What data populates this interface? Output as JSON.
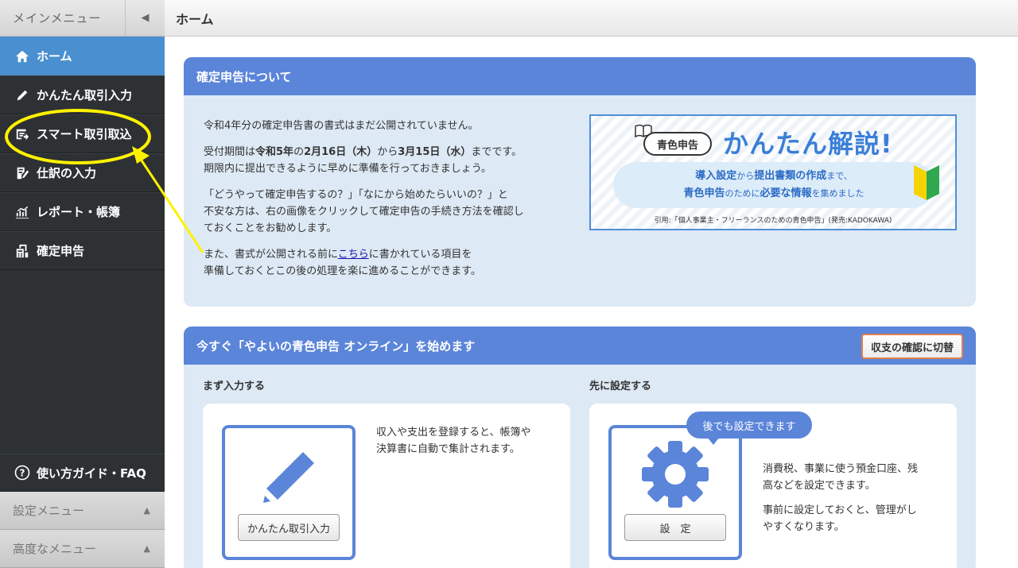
{
  "sidebar": {
    "title": "メインメニュー",
    "collapse_icon": "triangle-left-icon",
    "items": [
      {
        "label": "ホーム",
        "icon": "home-icon",
        "active": true
      },
      {
        "label": "かんたん取引入力",
        "icon": "pencil-icon"
      },
      {
        "label": "スマート取引取込",
        "icon": "import-icon"
      },
      {
        "label": "仕訳の入力",
        "icon": "journal-icon"
      },
      {
        "label": "レポート・帳簿",
        "icon": "report-chart-icon"
      },
      {
        "label": "確定申告",
        "icon": "calculator-icon"
      }
    ],
    "guide_label": "使い方ガイド・FAQ",
    "settings_menu": "設定メニュー",
    "advanced_menu": "高度なメニュー"
  },
  "header": {
    "title": "ホーム"
  },
  "card1": {
    "title": "確定申告について",
    "p1": "令和4年分の確定申告書の書式はまだ公開されていません。",
    "p2_a": "受付期間は",
    "p2_b1": "令和5年",
    "p2_c1": "の",
    "p2_b2": "2月16日（木）",
    "p2_c2": "から",
    "p2_b3": "3月15日（水）",
    "p2_d": "までです。",
    "p2_e": "期限内に提出できるように早めに準備を行っておきましょう。",
    "p3_a": "「どうやって確定申告するの？」「なにから始めたらいいの？」と",
    "p3_b": "不安な方は、右の画像をクリックして確定申告の手続き方法を確認し",
    "p3_c": "ておくことをお勧めします。",
    "p4_a": "また、書式が公開される前に",
    "p4_link": "こちら",
    "p4_b": "に書かれている項目を",
    "p4_c": "準備しておくとこの後の処理を楽に進めることができます。",
    "banner": {
      "tag": "青色申告",
      "title": "かんたん解説!",
      "line1_a": "導入設定",
      "line1_b": "から",
      "line1_c": "提出書類の作成",
      "line1_d": "まで、",
      "line2_a": "青色申告",
      "line2_b": "のために",
      "line2_c": "必要な情報",
      "line2_d": "を集めました",
      "cite": "引用:「個人事業主・フリーランスのための青色申告」(発売:KADOKAWA)"
    }
  },
  "card2": {
    "title": "今すぐ「やよいの青色申告 オンライン」を始めます",
    "switch_label": "収支の確認に切替",
    "left": {
      "heading": "まず入力する",
      "button": "かんたん取引入力",
      "desc1": "収入や支出を登録すると、帳簿や",
      "desc2": "決算書に自動で集計されます。"
    },
    "right": {
      "heading": "先に設定する",
      "bubble": "後でも設定できます",
      "button": "設　定",
      "desc1": "消費税、事業に使う預金口座、残",
      "desc2": "高などを設定できます。",
      "desc3": "事前に設定しておくと、管理がし",
      "desc4": "やすくなります。"
    }
  },
  "colors": {
    "accent": "#5b85d9",
    "sidebar": "#2d3134",
    "active": "#4a8fd0",
    "highlight": "#fff200"
  }
}
